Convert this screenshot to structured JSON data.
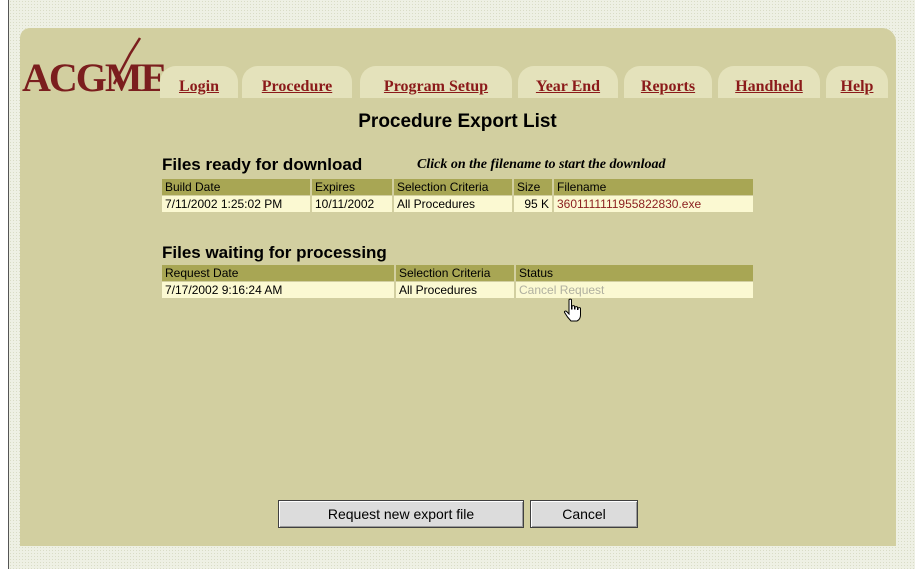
{
  "logo": {
    "text": "ACGME"
  },
  "nav": {
    "tabs": [
      {
        "label": "Login"
      },
      {
        "label": "Procedure"
      },
      {
        "label": "Program Setup"
      },
      {
        "label": "Year End"
      },
      {
        "label": "Reports"
      },
      {
        "label": "Handheld"
      },
      {
        "label": "Help"
      }
    ]
  },
  "page": {
    "title": "Procedure Export List"
  },
  "ready": {
    "title": "Files ready for download",
    "hint": "Click on the filename to start the download",
    "columns": [
      "Build Date",
      "Expires",
      "Selection Criteria",
      "Size",
      "Filename"
    ],
    "rows": [
      {
        "build_date": "7/11/2002 1:25:02 PM",
        "expires": "10/11/2002",
        "criteria": "All Procedures",
        "size": "95 K",
        "filename": "3601111111955822830.exe"
      }
    ]
  },
  "waiting": {
    "title": "Files waiting for processing",
    "columns": [
      "Request Date",
      "Selection Criteria",
      "Status"
    ],
    "rows": [
      {
        "request_date": "7/17/2002 9:16:24 AM",
        "criteria": "All Procedures",
        "status": "Cancel Request"
      }
    ]
  },
  "buttons": {
    "request_new": "Request new export file",
    "cancel": "Cancel"
  },
  "colors": {
    "panel": "#d2cfa0",
    "tab": "#e4e2bb",
    "header_cell": "#a8a654",
    "data_cell": "#fbf9d2",
    "link": "#8b1a1a"
  },
  "icons": {
    "cursor": "hand-pointer-icon"
  }
}
